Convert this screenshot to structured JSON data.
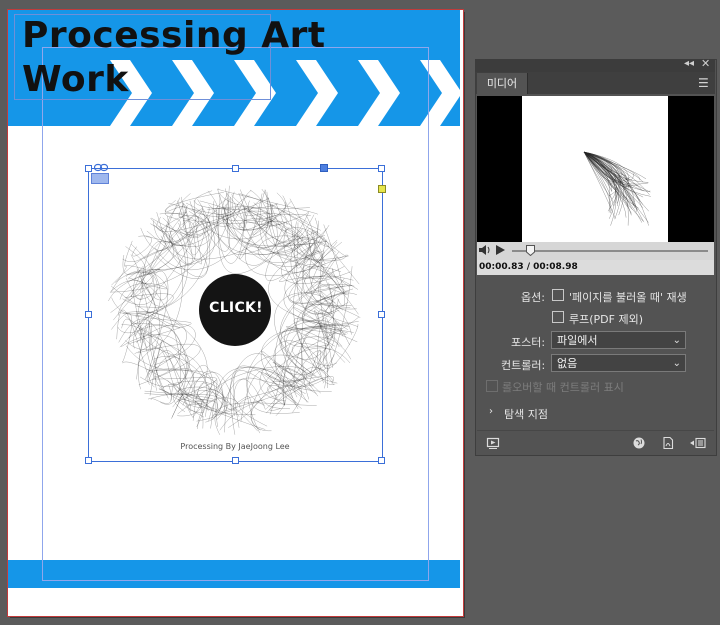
{
  "document": {
    "title_line_1": "Processing Art",
    "title_line_2": "Work",
    "click_label": "CLICK!",
    "caption": "Processing By JaeJoong Lee",
    "colors": {
      "accent": "#1596e8",
      "page": "#ffffff",
      "selection": "#3b6fd8"
    }
  },
  "media_panel": {
    "tab_label": "미디어",
    "time_current": "00:00.83",
    "time_total": "00:08.98",
    "playback_progress": 0.09,
    "options_label": "옵션:",
    "option_play_on_load": "'페이지를 불러올 때' 재생",
    "option_loop": "루프(PDF 제외)",
    "poster_label": "포스터:",
    "poster_value": "파일에서",
    "controller_label": "컨트롤러:",
    "controller_value": "없음",
    "show_on_rollover": "롤오버할 때 컨트롤러 표시",
    "navigation_points": "탐색 지점",
    "icons": [
      "preview-icon",
      "globe-icon",
      "pdf-export-icon",
      "insert-media-icon"
    ]
  }
}
